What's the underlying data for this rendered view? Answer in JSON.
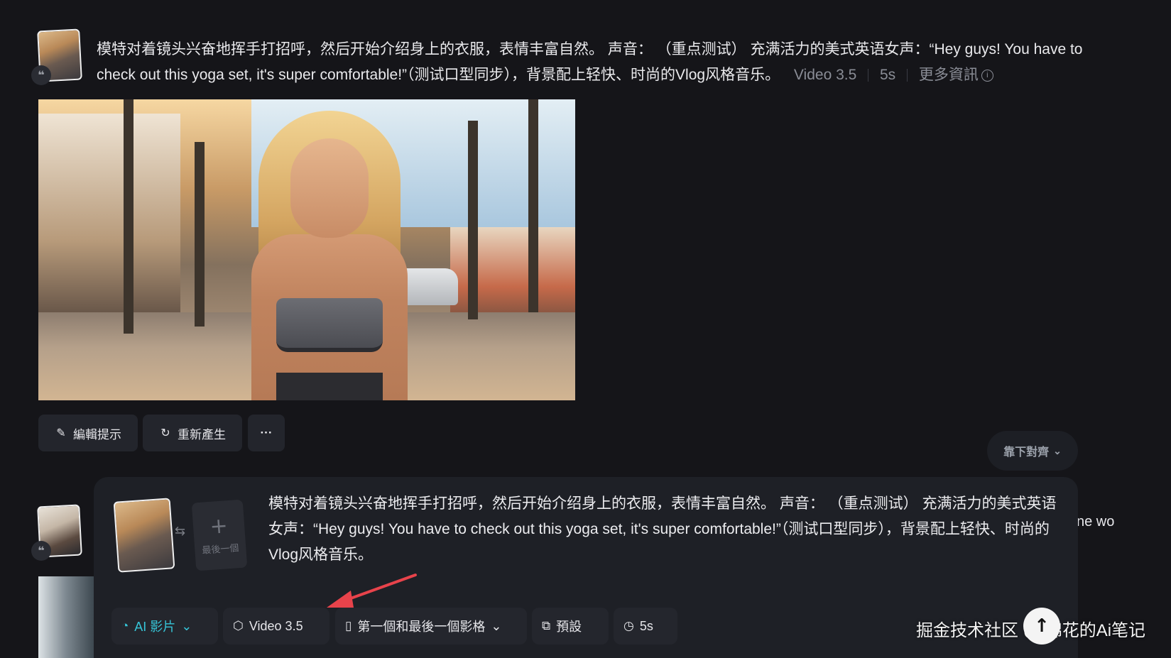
{
  "message1": {
    "prompt": "模特对着镜头兴奋地挥手打招呼，然后开始介绍身上的衣服，表情丰富自然。 声音： （重点测试） 充满活力的美式英语女声：“Hey guys! You have to check out this yoga set, it's super comfortable!”（测试口型同步），背景配上轻快、时尚的Vlog风格音乐。",
    "model": "Video 3.5",
    "duration": "5s",
    "more_info": "更多資訊",
    "actions": {
      "edit": "編輯提示",
      "regenerate": "重新產生",
      "more": "···"
    }
  },
  "align_button": "靠下對齊",
  "composer": {
    "prompt": "模特对着镜头兴奋地挥手打招呼，然后开始介绍身上的衣服，表情丰富自然。 声音： （重点测试） 充满活力的美式英语女声：“Hey guys! You have to check out this yoga set, it's super comfortable!”（测试口型同步），背景配上轻快、时尚的Vlog风格音乐。",
    "last_frame_label": "最後一個",
    "toolbar": {
      "mode": "AI 影片",
      "model": "Video 3.5",
      "frames": "第一個和最後一個影格",
      "preset": "預設",
      "duration": "5s"
    }
  },
  "side_fragment": "ne wo",
  "watermark": "掘金技术社区 @ 棉花的Ai笔记",
  "colors": {
    "background": "#151519",
    "panel": "#1e2026",
    "accent": "#36c5d8",
    "arrow": "#e8434b"
  }
}
